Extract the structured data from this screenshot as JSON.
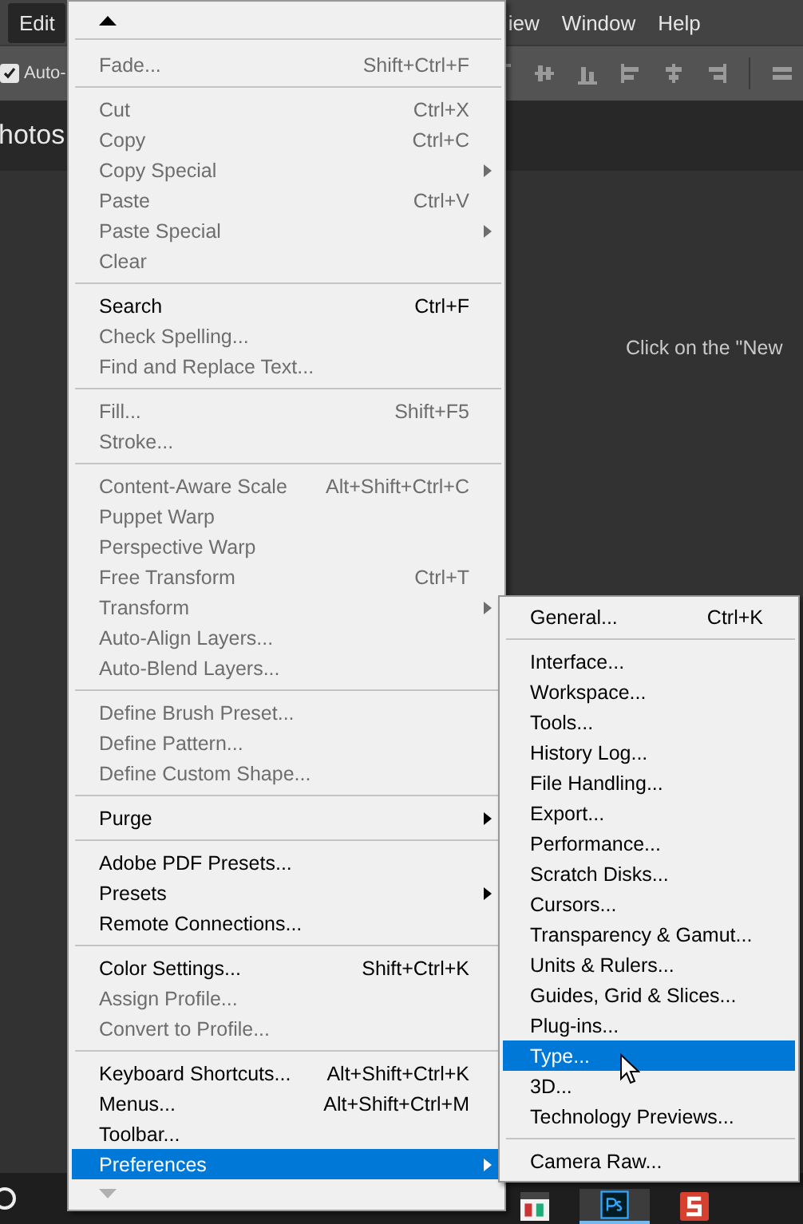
{
  "menubar": [
    {
      "label": "Edit",
      "selected": true
    },
    {
      "label": "iew",
      "selected": false
    },
    {
      "label": "Window",
      "selected": false
    },
    {
      "label": "Help",
      "selected": false
    }
  ],
  "options_bar": {
    "auto_select": {
      "label": "Auto-",
      "checked": true
    }
  },
  "document": {
    "tab_title": "hotos",
    "hint": "Click on the \"New"
  },
  "edit_menu": {
    "items": [
      {
        "kind": "item",
        "label": "Fade...",
        "shortcut": "Shift+Ctrl+F",
        "disabled": true,
        "selected": false
      },
      {
        "kind": "separator"
      },
      {
        "kind": "item",
        "label": "Cut",
        "shortcut": "Ctrl+X",
        "disabled": true,
        "selected": false
      },
      {
        "kind": "item",
        "label": "Copy",
        "shortcut": "Ctrl+C",
        "disabled": true,
        "selected": false
      },
      {
        "kind": "item",
        "label": "Copy Special",
        "submenu": true,
        "disabled": true,
        "selected": false
      },
      {
        "kind": "item",
        "label": "Paste",
        "shortcut": "Ctrl+V",
        "disabled": true,
        "selected": false
      },
      {
        "kind": "item",
        "label": "Paste Special",
        "submenu": true,
        "disabled": true,
        "selected": false
      },
      {
        "kind": "item",
        "label": "Clear",
        "disabled": true,
        "selected": false
      },
      {
        "kind": "separator"
      },
      {
        "kind": "item",
        "label": "Search",
        "shortcut": "Ctrl+F",
        "disabled": false,
        "selected": false
      },
      {
        "kind": "item",
        "label": "Check Spelling...",
        "disabled": true,
        "selected": false
      },
      {
        "kind": "item",
        "label": "Find and Replace Text...",
        "disabled": true,
        "selected": false
      },
      {
        "kind": "separator"
      },
      {
        "kind": "item",
        "label": "Fill...",
        "shortcut": "Shift+F5",
        "disabled": true,
        "selected": false
      },
      {
        "kind": "item",
        "label": "Stroke...",
        "disabled": true,
        "selected": false
      },
      {
        "kind": "separator"
      },
      {
        "kind": "item",
        "label": "Content-Aware Scale",
        "shortcut": "Alt+Shift+Ctrl+C",
        "disabled": true,
        "selected": false
      },
      {
        "kind": "item",
        "label": "Puppet Warp",
        "disabled": true,
        "selected": false
      },
      {
        "kind": "item",
        "label": "Perspective Warp",
        "disabled": true,
        "selected": false
      },
      {
        "kind": "item",
        "label": "Free Transform",
        "shortcut": "Ctrl+T",
        "disabled": true,
        "selected": false
      },
      {
        "kind": "item",
        "label": "Transform",
        "submenu": true,
        "disabled": true,
        "selected": false
      },
      {
        "kind": "item",
        "label": "Auto-Align Layers...",
        "disabled": true,
        "selected": false
      },
      {
        "kind": "item",
        "label": "Auto-Blend Layers...",
        "disabled": true,
        "selected": false
      },
      {
        "kind": "separator"
      },
      {
        "kind": "item",
        "label": "Define Brush Preset...",
        "disabled": true,
        "selected": false
      },
      {
        "kind": "item",
        "label": "Define Pattern...",
        "disabled": true,
        "selected": false
      },
      {
        "kind": "item",
        "label": "Define Custom Shape...",
        "disabled": true,
        "selected": false
      },
      {
        "kind": "separator"
      },
      {
        "kind": "item",
        "label": "Purge",
        "submenu": true,
        "disabled": false,
        "selected": false
      },
      {
        "kind": "separator"
      },
      {
        "kind": "item",
        "label": "Adobe PDF Presets...",
        "disabled": false,
        "selected": false
      },
      {
        "kind": "item",
        "label": "Presets",
        "submenu": true,
        "disabled": false,
        "selected": false
      },
      {
        "kind": "item",
        "label": "Remote Connections...",
        "disabled": false,
        "selected": false
      },
      {
        "kind": "separator"
      },
      {
        "kind": "item",
        "label": "Color Settings...",
        "shortcut": "Shift+Ctrl+K",
        "disabled": false,
        "selected": false
      },
      {
        "kind": "item",
        "label": "Assign Profile...",
        "disabled": true,
        "selected": false
      },
      {
        "kind": "item",
        "label": "Convert to Profile...",
        "disabled": true,
        "selected": false
      },
      {
        "kind": "separator"
      },
      {
        "kind": "item",
        "label": "Keyboard Shortcuts...",
        "shortcut": "Alt+Shift+Ctrl+K",
        "disabled": false,
        "selected": false
      },
      {
        "kind": "item",
        "label": "Menus...",
        "shortcut": "Alt+Shift+Ctrl+M",
        "disabled": false,
        "selected": false
      },
      {
        "kind": "item",
        "label": "Toolbar...",
        "disabled": false,
        "selected": false
      },
      {
        "kind": "item",
        "label": "Preferences",
        "submenu": true,
        "disabled": false,
        "selected": true
      }
    ]
  },
  "preferences_submenu": {
    "items": [
      {
        "kind": "item",
        "label": "General...",
        "shortcut": "Ctrl+K",
        "disabled": false,
        "selected": false
      },
      {
        "kind": "separator"
      },
      {
        "kind": "item",
        "label": "Interface...",
        "disabled": false,
        "selected": false
      },
      {
        "kind": "item",
        "label": "Workspace...",
        "disabled": false,
        "selected": false
      },
      {
        "kind": "item",
        "label": "Tools...",
        "disabled": false,
        "selected": false
      },
      {
        "kind": "item",
        "label": "History Log...",
        "disabled": false,
        "selected": false
      },
      {
        "kind": "item",
        "label": "File Handling...",
        "disabled": false,
        "selected": false
      },
      {
        "kind": "item",
        "label": "Export...",
        "disabled": false,
        "selected": false
      },
      {
        "kind": "item",
        "label": "Performance...",
        "disabled": false,
        "selected": false
      },
      {
        "kind": "item",
        "label": "Scratch Disks...",
        "disabled": false,
        "selected": false
      },
      {
        "kind": "item",
        "label": "Cursors...",
        "disabled": false,
        "selected": false
      },
      {
        "kind": "item",
        "label": "Transparency & Gamut...",
        "disabled": false,
        "selected": false
      },
      {
        "kind": "item",
        "label": "Units & Rulers...",
        "disabled": false,
        "selected": false
      },
      {
        "kind": "item",
        "label": "Guides, Grid & Slices...",
        "disabled": false,
        "selected": false
      },
      {
        "kind": "item",
        "label": "Plug-ins...",
        "disabled": false,
        "selected": false
      },
      {
        "kind": "item",
        "label": "Type...",
        "disabled": false,
        "selected": true
      },
      {
        "kind": "item",
        "label": "3D...",
        "disabled": false,
        "selected": false
      },
      {
        "kind": "item",
        "label": "Technology Previews...",
        "disabled": false,
        "selected": false
      },
      {
        "kind": "separator"
      },
      {
        "kind": "item",
        "label": "Camera Raw...",
        "disabled": false,
        "selected": false
      }
    ]
  }
}
